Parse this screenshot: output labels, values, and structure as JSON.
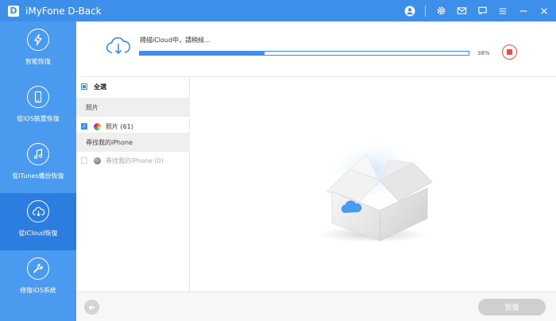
{
  "window": {
    "logo_letter": "D",
    "title": "iMyFone D-Back"
  },
  "titlebar_icons": [
    "account-icon",
    "gear-icon",
    "mail-icon",
    "feedback-icon",
    "menu-icon",
    "minimize-icon",
    "close-icon"
  ],
  "sidebar": {
    "items": [
      {
        "label": "智能恢復",
        "icon": "smart-recovery-icon",
        "active": false
      },
      {
        "label": "從iOS裝置恢復",
        "icon": "ios-device-icon",
        "active": false
      },
      {
        "label": "從iTunes備份恢復",
        "icon": "itunes-music-icon",
        "active": false
      },
      {
        "label": "從iCloud恢復",
        "icon": "icloud-download-icon",
        "active": true
      },
      {
        "label": "修復iOS系統",
        "icon": "wrench-icon",
        "active": false
      }
    ]
  },
  "scan": {
    "status": "掃描iCloud中，請稍候...",
    "progress": 38,
    "percent_label": "38%"
  },
  "list": {
    "select_all": "全選",
    "categories": [
      {
        "name": "照片",
        "items": [
          {
            "label": "照片 (61)",
            "checked": true
          }
        ]
      },
      {
        "name": "尋找我的iPhone",
        "items": [
          {
            "label": "尋找我的iPhone (0)",
            "checked": false
          }
        ]
      }
    ]
  },
  "footer": {
    "recover_label": "恢復"
  },
  "colors": {
    "brand": "#3d8fe9",
    "sidebar": "#4a9bf0",
    "sidebar_active": "#2c7de0",
    "stop": "#e05252"
  }
}
